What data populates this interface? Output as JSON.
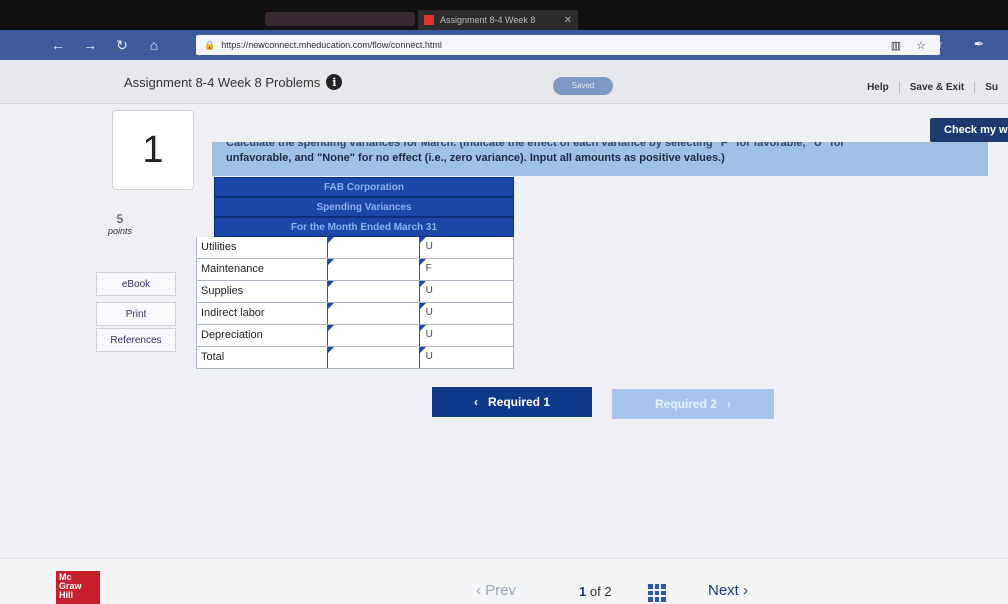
{
  "browser": {
    "tab_title": "Assignment 8-4 Week 8",
    "tab_close": "✕",
    "url": "https://newconnect.mheducation.com/flow/connect.html",
    "nav": [
      "←",
      "→",
      "↻",
      "⌂"
    ],
    "address_icons": "▥ ☆",
    "toolbar_right": "✩ ✒"
  },
  "app": {
    "title": "Assignment 8-4 Week 8 Problems",
    "info_icon": "i",
    "saved": "Saved",
    "links": [
      "Help",
      "Save & Exit",
      "Su"
    ],
    "check_button": "Check my w"
  },
  "question": {
    "number": "1",
    "points": "5",
    "points_label": "points",
    "side_buttons": [
      "eBook",
      "Print",
      "References"
    ],
    "instruction_cut": "Calculate the spending variances for March. (Indicate the effect of each variance by selecting \"F\" for favorable, \"U\" for",
    "instruction": "unfavorable, and \"None\" for no effect (i.e., zero variance). Input all amounts as positive values.)"
  },
  "report": {
    "header": [
      "FAB Corporation",
      "Spending Variances",
      "For the Month Ended March 31"
    ],
    "rows": [
      {
        "label": "Utilities",
        "fu": "U"
      },
      {
        "label": "Maintenance",
        "fu": "F"
      },
      {
        "label": "Supplies",
        "fu": "U"
      },
      {
        "label": "Indirect labor",
        "fu": "U"
      },
      {
        "label": "Depreciation",
        "fu": "U"
      },
      {
        "label": "Total",
        "fu": "U"
      }
    ]
  },
  "buttons": {
    "required1": "Required 1",
    "required1_icon": "‹",
    "required2": "Required 2",
    "required2_icon": "›"
  },
  "footer": {
    "logo": [
      "Mc",
      "Graw",
      "Hill"
    ],
    "prev": "‹ Prev",
    "page_current": "1",
    "page_of": "of",
    "page_total": "2",
    "next": "Next ›"
  }
}
